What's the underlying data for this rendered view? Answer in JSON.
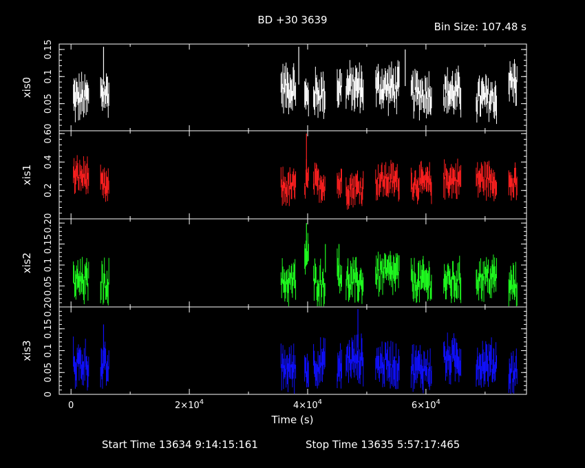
{
  "title": "BD +30 3639",
  "bin_size": "Bin Size: 107.48 s",
  "footer": {
    "start": "Start Time 13634  9:14:15:161",
    "stop": "Stop Time 13635  5:57:17:465"
  },
  "chart_data": {
    "type": "line",
    "xlabel": "Time (s)",
    "xlim": [
      -2000,
      77000
    ],
    "x_ticks": [
      0,
      20000,
      40000,
      60000
    ],
    "x_tick_labels": [
      {
        "base": "0",
        "exp": ""
      },
      {
        "base": "2×10",
        "exp": "4"
      },
      {
        "base": "4×10",
        "exp": "4"
      },
      {
        "base": "6×10",
        "exp": "4"
      }
    ],
    "segments": [
      [
        400,
        3000
      ],
      [
        5000,
        6500
      ],
      [
        35500,
        38000
      ],
      [
        39500,
        40200
      ],
      [
        41000,
        43000
      ],
      [
        45000,
        45800
      ],
      [
        46500,
        49500
      ],
      [
        51500,
        55500
      ],
      [
        57500,
        61000
      ],
      [
        63000,
        66000
      ],
      [
        68500,
        72000
      ],
      [
        74000,
        75500
      ]
    ],
    "panels": [
      {
        "name": "xis0",
        "color": "#ffffff",
        "ylim": [
          0,
          0.16
        ],
        "y_ticks": [
          0.05,
          0.1,
          0.15
        ],
        "y_tick_labels": [
          "0.05",
          "0.1",
          "0.15"
        ],
        "mean": [
          0.06,
          0.07,
          0.08,
          0.06,
          0.07,
          0.08,
          0.08,
          0.08,
          0.07,
          0.07,
          0.06,
          0.09
        ],
        "spread": 0.05,
        "spikes": [
          [
            5500,
            0.155
          ],
          [
            38500,
            0.155
          ],
          [
            56500,
            0.15
          ]
        ]
      },
      {
        "name": "xis1",
        "color": "#ff2020",
        "ylim": [
          0,
          0.62
        ],
        "y_ticks": [
          0.2,
          0.4,
          0.6
        ],
        "y_tick_labels": [
          "0.2",
          "0.4",
          "0.60"
        ],
        "mean": [
          0.3,
          0.22,
          0.22,
          0.25,
          0.25,
          0.25,
          0.22,
          0.27,
          0.25,
          0.28,
          0.28,
          0.24
        ],
        "spread": 0.15,
        "spikes": [
          [
            39800,
            0.6
          ],
          [
            39800,
            0.42
          ]
        ]
      },
      {
        "name": "xis2",
        "color": "#20ff20",
        "ylim": [
          0,
          0.21
        ],
        "y_ticks": [
          0.05,
          0.1,
          0.15,
          0.2
        ],
        "y_tick_labels": [
          "0.05",
          "0.1",
          "0.15",
          "0.20"
        ],
        "mean": [
          0.06,
          0.06,
          0.06,
          0.12,
          0.06,
          0.08,
          0.06,
          0.08,
          0.06,
          0.06,
          0.07,
          0.05
        ],
        "spread": 0.06,
        "spikes": [
          [
            39800,
            0.2
          ],
          [
            43000,
            0.15
          ],
          [
            45300,
            0.15
          ]
        ]
      },
      {
        "name": "xis3",
        "color": "#1010ff",
        "ylim": [
          0,
          0.2
        ],
        "y_ticks": [
          0,
          0.05,
          0.1,
          0.15,
          0.2
        ],
        "y_tick_labels": [
          "0",
          "0.05",
          "0.1",
          "0.15",
          "0.20"
        ],
        "mean": [
          0.07,
          0.06,
          0.06,
          0.06,
          0.07,
          0.06,
          0.08,
          0.07,
          0.06,
          0.08,
          0.07,
          0.05
        ],
        "spread": 0.06,
        "spikes": [
          [
            5500,
            0.16
          ],
          [
            48500,
            0.195
          ]
        ]
      }
    ]
  }
}
